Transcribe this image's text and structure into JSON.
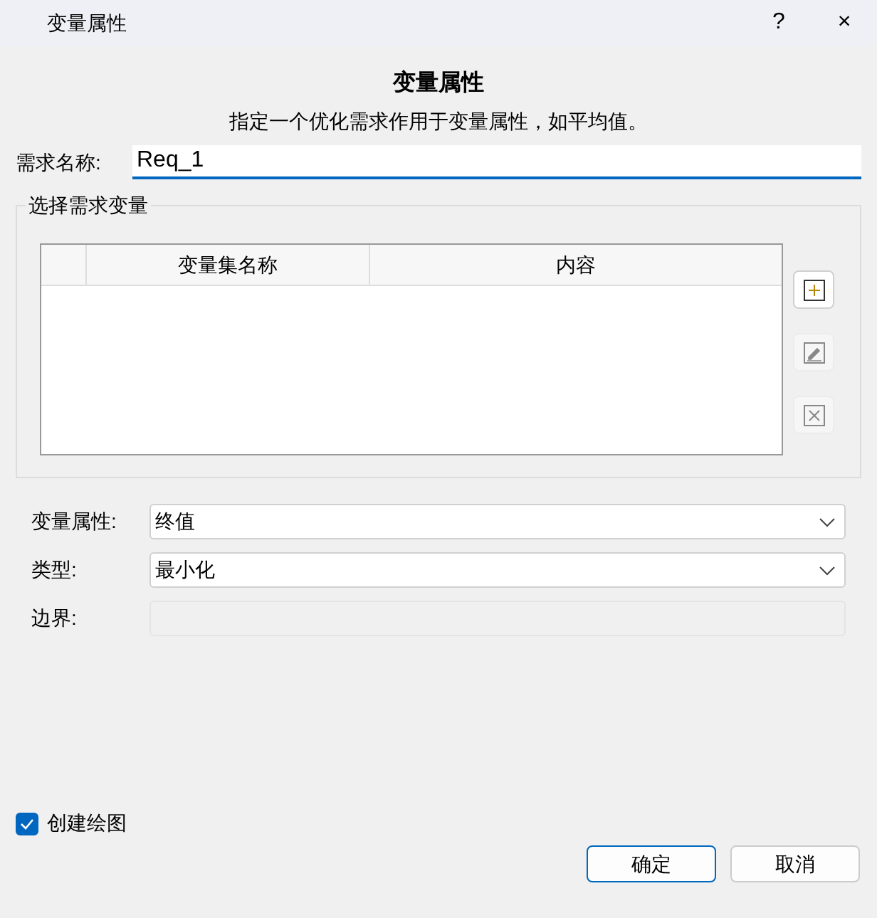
{
  "window": {
    "title": "变量属性",
    "help": "?",
    "close": "×"
  },
  "heading": "变量属性",
  "description": "指定一个优化需求作用于变量属性，如平均值。",
  "name_field": {
    "label": "需求名称:",
    "value": "Req_1"
  },
  "group": {
    "title": "选择需求变量",
    "table": {
      "columns": [
        "变量集名称",
        "内容"
      ]
    },
    "buttons": [
      {
        "kind": "add",
        "disabled": false
      },
      {
        "kind": "edit",
        "disabled": true
      },
      {
        "kind": "delete",
        "disabled": true
      }
    ]
  },
  "fields": [
    {
      "label": "变量属性:",
      "kind": "select",
      "value": "终值",
      "disabled": false
    },
    {
      "label": "类型:",
      "kind": "select",
      "value": "最小化",
      "disabled": false
    },
    {
      "label": "边界:",
      "kind": "text",
      "disabled": true
    }
  ],
  "create_plot": {
    "label": "创建绘图",
    "checked": true
  },
  "buttons": [
    {
      "label": "确定",
      "default": true
    },
    {
      "label": "取消",
      "default": false
    }
  ]
}
